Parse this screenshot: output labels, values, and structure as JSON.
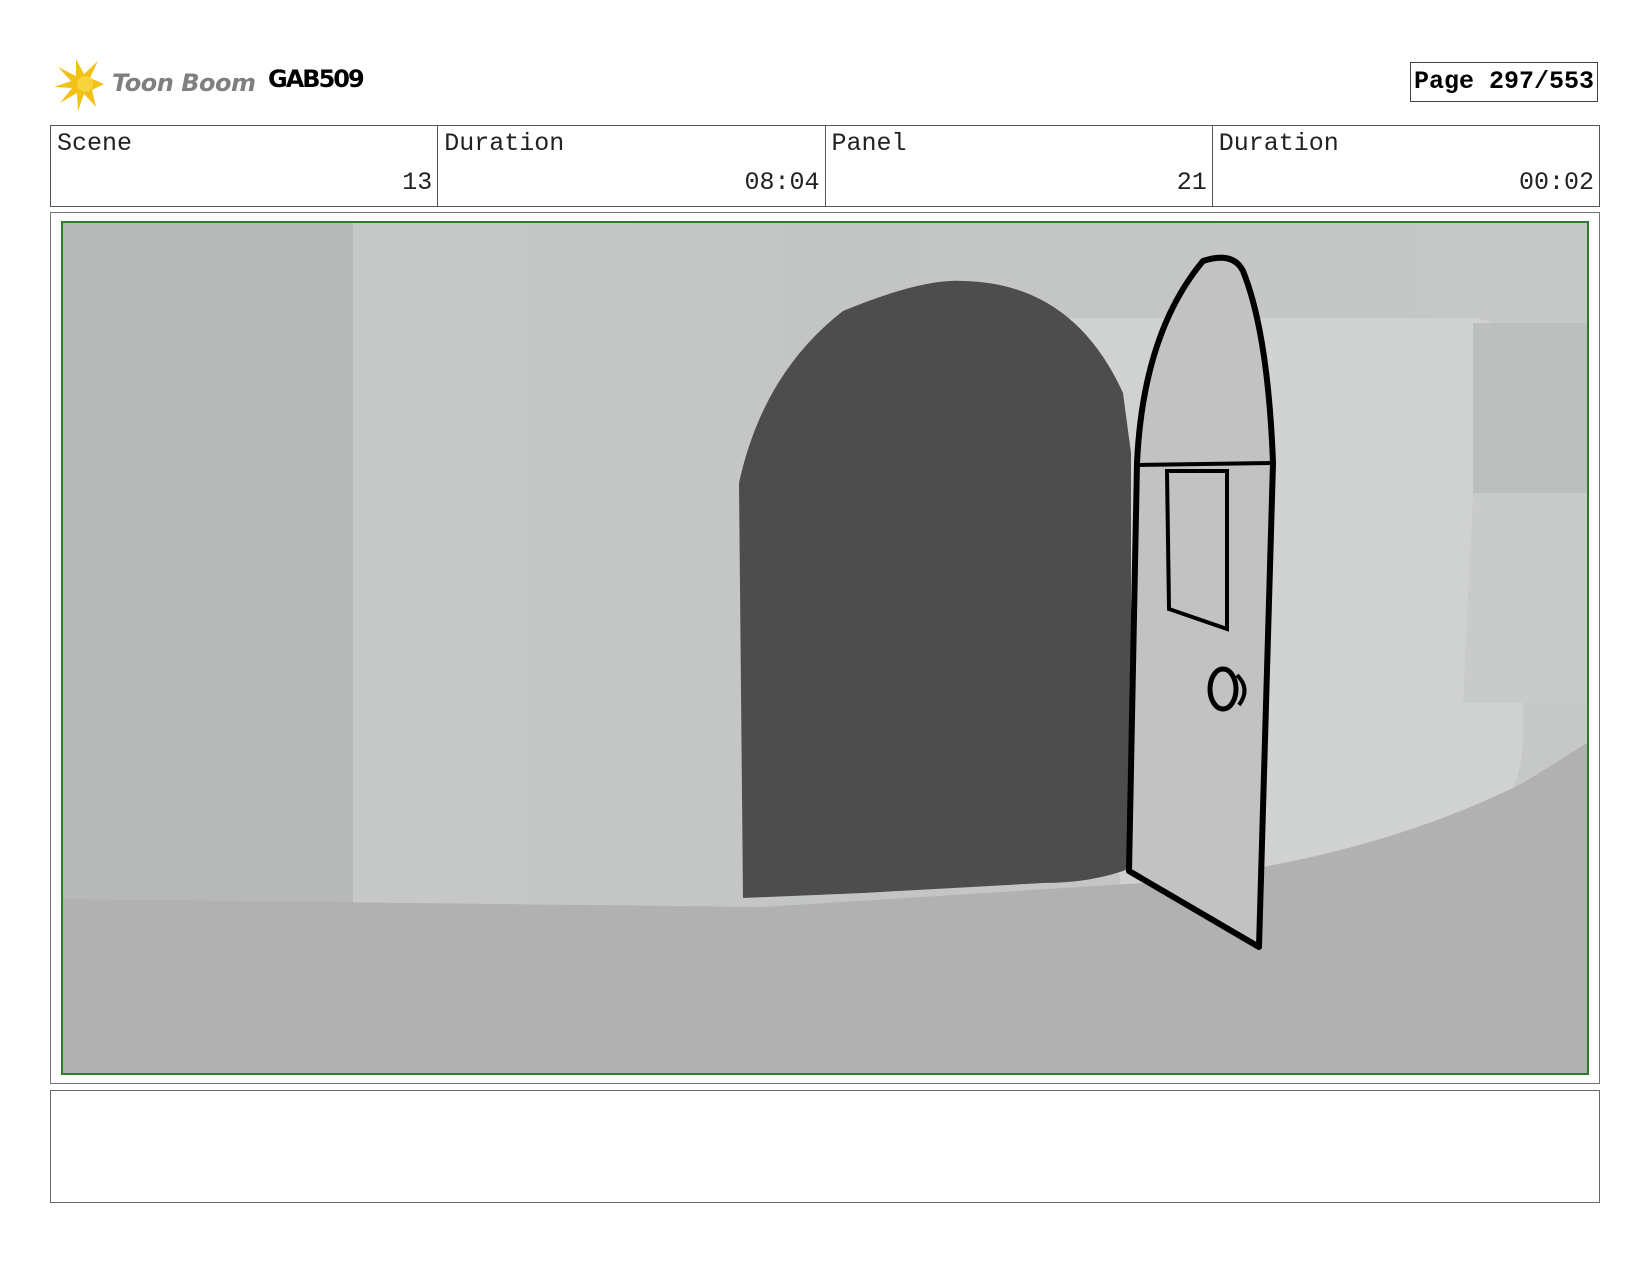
{
  "header": {
    "logo_text": "Toon Boom",
    "project_id": "GAB509",
    "page_label": "Page 297/553"
  },
  "info": {
    "scene_label": "Scene",
    "scene_value": "13",
    "scene_duration_label": "Duration",
    "scene_duration_value": "08:04",
    "panel_label": "Panel",
    "panel_value": "21",
    "panel_duration_label": "Duration",
    "panel_duration_value": "00:02"
  },
  "notes": {
    "text": ""
  },
  "colors": {
    "panel_border": "#2f7a2f",
    "logo_star": "#f2c118",
    "wall": "#c4c6c5",
    "floor": "#b1b1b1",
    "doorway": "#4d4d4d",
    "door": "#c2c2c2"
  }
}
